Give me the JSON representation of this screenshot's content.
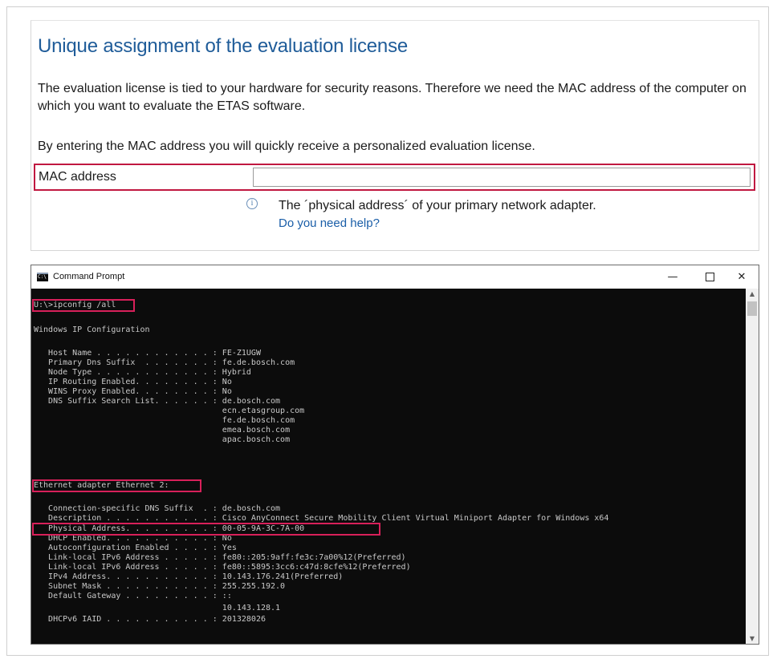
{
  "form": {
    "title": "Unique assignment of the evaluation license",
    "paragraph1": "The evaluation license is tied to your hardware for security reasons. Therefore we need the MAC address of the computer on which you want to evaluate the ETAS software.",
    "paragraph2": "By entering the MAC address you will quickly receive a personalized evaluation license.",
    "mac_label": "MAC address",
    "mac_value": "",
    "mac_placeholder": "",
    "hint_icon": "i",
    "hint_text": "The ´physical address´ of your primary network adapter.",
    "help_link": "Do you need help?",
    "highlight_color": "#c01840"
  },
  "cmd": {
    "title": "Command Prompt",
    "icon_text": "C:\\",
    "minimize": "—",
    "close": "✕",
    "scroll_up": "▲",
    "scroll_down": "▼",
    "lines": [
      "U:\\>ipconfig /all",
      "",
      "Windows IP Configuration",
      "",
      "   Host Name . . . . . . . . . . . . : FE-Z1UGW",
      "   Primary Dns Suffix  . . . . . . . : fe.de.bosch.com",
      "   Node Type . . . . . . . . . . . . : Hybrid",
      "   IP Routing Enabled. . . . . . . . : No",
      "   WINS Proxy Enabled. . . . . . . . : No",
      "   DNS Suffix Search List. . . . . . : de.bosch.com",
      "                                       ecn.etasgroup.com",
      "                                       fe.de.bosch.com",
      "                                       emea.bosch.com",
      "                                       apac.bosch.com",
      "",
      "Ethernet adapter Ethernet 2:",
      "",
      "   Connection-specific DNS Suffix  . : de.bosch.com",
      "   Description . . . . . . . . . . . : Cisco AnyConnect Secure Mobility Client Virtual Miniport Adapter for Windows x64",
      "   Physical Address. . . . . . . . . : 00-05-9A-3C-7A-00",
      "   DHCP Enabled. . . . . . . . . . . : No",
      "   Autoconfiguration Enabled . . . . : Yes",
      "   Link-local IPv6 Address . . . . . : fe80::205:9aff:fe3c:7a00%12(Preferred)",
      "   Link-local IPv6 Address . . . . . : fe80::5895:3cc6:c47d:8cfe%12(Preferred)",
      "   IPv4 Address. . . . . . . . . . . : 10.143.176.241(Preferred)",
      "   Subnet Mask . . . . . . . . . . . : 255.255.192.0",
      "   Default Gateway . . . . . . . . . : ::",
      "                                       10.143.128.1",
      "   DHCPv6 IAID . . . . . . . . . . . : 201328026"
    ]
  }
}
